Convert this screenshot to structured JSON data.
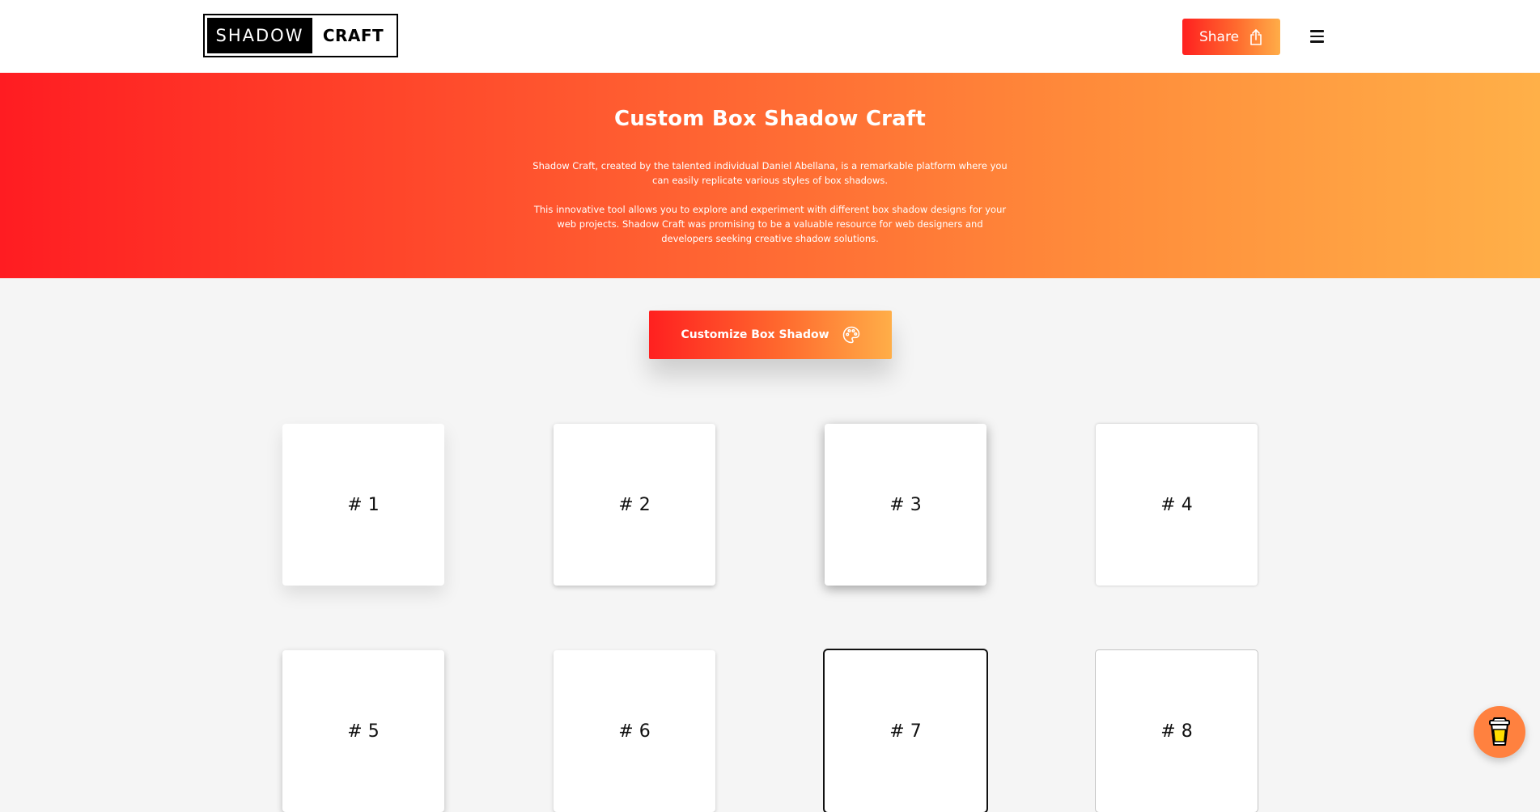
{
  "header": {
    "logo_dark": "SHADOW",
    "logo_light": "CRAFT",
    "share_label": "Share"
  },
  "hero": {
    "title": "Custom Box Shadow Craft",
    "paragraph1": "Shadow Craft, created by the talented individual Daniel Abellana, is a remarkable platform where you can easily replicate various styles of box shadows.",
    "paragraph2": "This innovative tool allows you to explore and experiment with different box shadow designs for your web projects. Shadow Craft was promising to be a valuable resource for web designers and developers seeking creative shadow solutions."
  },
  "customize": {
    "label": "Customize Box Shadow"
  },
  "cards": [
    {
      "label": "# 1"
    },
    {
      "label": "# 2"
    },
    {
      "label": "# 3"
    },
    {
      "label": "# 4"
    },
    {
      "label": "# 5"
    },
    {
      "label": "# 6"
    },
    {
      "label": "# 7"
    },
    {
      "label": "# 8"
    }
  ],
  "icons": {
    "share": "share-icon",
    "menu": "hamburger-menu-icon",
    "palette": "palette-icon",
    "coffee": "coffee-cup-icon"
  },
  "colors": {
    "gradient_start": "#ff1c22",
    "gradient_end": "#ffb048",
    "coffee_button": "#ff813f"
  }
}
